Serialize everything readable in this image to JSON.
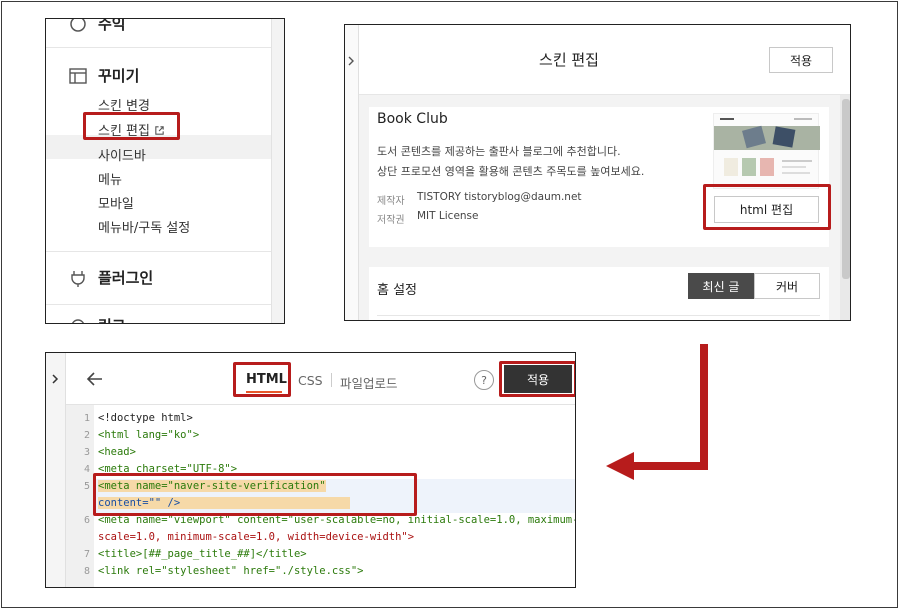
{
  "sidebar": {
    "top_item": "수익",
    "section_decor": "꾸미기",
    "items": [
      "스킨 변경",
      "스킨 편집",
      "사이드바",
      "메뉴",
      "모바일",
      "메뉴바/구독 설정"
    ],
    "section_plugin": "플러그인",
    "bottom_item": "링크"
  },
  "skin_editor": {
    "title": "스킨 편집",
    "apply_label": "적용",
    "skin_name": "Book Club",
    "desc_line1": "도서 콘텐츠를 제공하는 출판사 블로그에 추천합니다.",
    "desc_line2": "상단 프로모션 영역을 활용해 콘텐츠 주목도를 높여보세요.",
    "maker_label": "제작자",
    "maker_value": "TISTORY tistoryblog@daum.net",
    "license_label": "저작권",
    "license_value": "MIT License",
    "html_edit_label": "html 편집",
    "home_settings": "홈 설정",
    "tab_recent": "최신 글",
    "tab_cover": "커버"
  },
  "html_editor": {
    "tab_html": "HTML",
    "tab_css": "CSS",
    "tab_upload": "파일업로드",
    "help": "?",
    "apply_label": "적용",
    "code": [
      {
        "n": "1",
        "t": "<!doctype html>"
      },
      {
        "n": "2",
        "t": "<html lang=\"ko\">"
      },
      {
        "n": "3",
        "t": "<head>"
      },
      {
        "n": "4",
        "t": "<meta charset=\"UTF-8\">"
      },
      {
        "n": "5",
        "t": "<meta name=\"naver-site-verification\""
      },
      {
        "n": "",
        "t": "content=\"\" />"
      },
      {
        "n": "6",
        "t": "<meta name=\"viewport\" content=\"user-scalable=no, initial-scale=1.0, maximum-"
      },
      {
        "n": "",
        "t": "scale=1.0, minimum-scale=1.0, width=device-width\">"
      },
      {
        "n": "7",
        "t": "<title>[##_page_title_##]</title>"
      },
      {
        "n": "8",
        "t": "<link rel=\"stylesheet\" href=\"./style.css\">"
      }
    ]
  },
  "colors": {
    "highlight_red": "#b71c1c",
    "apply_dark": "#333333",
    "tab_active": "#4a4a4a"
  }
}
